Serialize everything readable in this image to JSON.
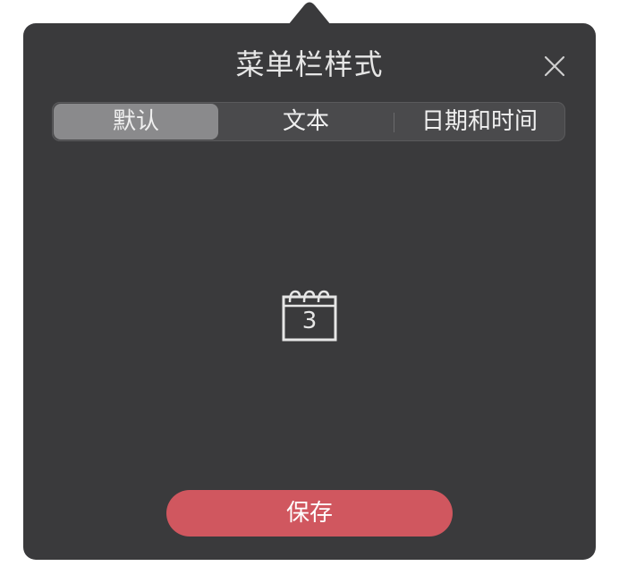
{
  "dialog": {
    "title": "菜单栏样式",
    "close_icon": "close-icon"
  },
  "tabs": [
    {
      "label": "默认",
      "selected": true
    },
    {
      "label": "文本",
      "selected": false
    },
    {
      "label": "日期和时间",
      "selected": false
    }
  ],
  "preview": {
    "icon": "calendar-icon",
    "day": "3"
  },
  "save_button": {
    "label": "保存"
  },
  "colors": {
    "background": "#3a3a3c",
    "accent": "#d0575f"
  }
}
